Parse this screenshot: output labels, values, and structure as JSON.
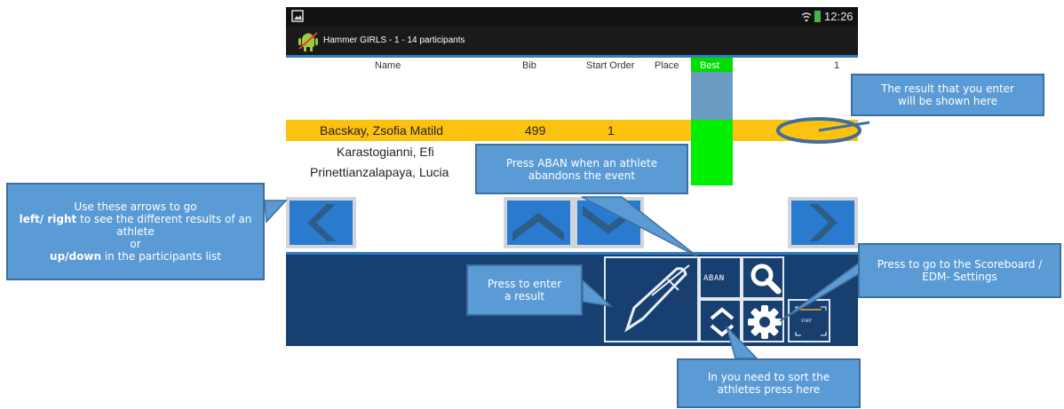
{
  "status_bar": {
    "time": "12:26"
  },
  "action_bar": {
    "title": "Hammer GIRLS - 1 - 14 participants"
  },
  "columns": {
    "name": "Name",
    "bib": "Bib",
    "start_order": "Start Order",
    "place": "Place",
    "best": "Best",
    "attempt": "1"
  },
  "participants": [
    {
      "name": "Bacskay, Zsofia Matild",
      "bib": "499",
      "start_order": "1"
    },
    {
      "name": "Karastogianni, Efi",
      "bib": "",
      "start_order": ""
    },
    {
      "name": "Prinettianzalapaya, Lucia",
      "bib": "",
      "start_order": ""
    }
  ],
  "toolbar": {
    "aban_label": "ABAN",
    "start_label": "START"
  },
  "callouts": {
    "result": "The result that you enter will be shown here",
    "aban": "Press ABAN when an athlete abandons the event",
    "arrows_line1": "Use these arrows to go",
    "arrows_lr": "left/ right",
    "arrows_line2": " to see the different results of an athlete",
    "arrows_or": "or",
    "arrows_ud": "up/down",
    "arrows_line3": " in the participants list",
    "enter": "Press to enter a result",
    "scoreboard": "Press to go to the Scoreboard / EDM- Settings",
    "sort": "In you need to sort the athletes press here"
  },
  "colors": {
    "highlight_row": "#fdc20f",
    "best_column": "#00ee00",
    "best_header_bg": "#00dd00",
    "toolbar_bg": "#173f6f",
    "callout_bg": "#5b9bd5",
    "nav_button": "#2a7ad0"
  },
  "icons": [
    "image-icon",
    "android-app-icon",
    "wifi-icon",
    "battery-icon",
    "chevron-left-icon",
    "chevron-up-icon",
    "chevron-down-icon",
    "chevron-right-icon",
    "pen-icon",
    "search-icon",
    "sort-icon",
    "gear-icon",
    "start-icon"
  ]
}
